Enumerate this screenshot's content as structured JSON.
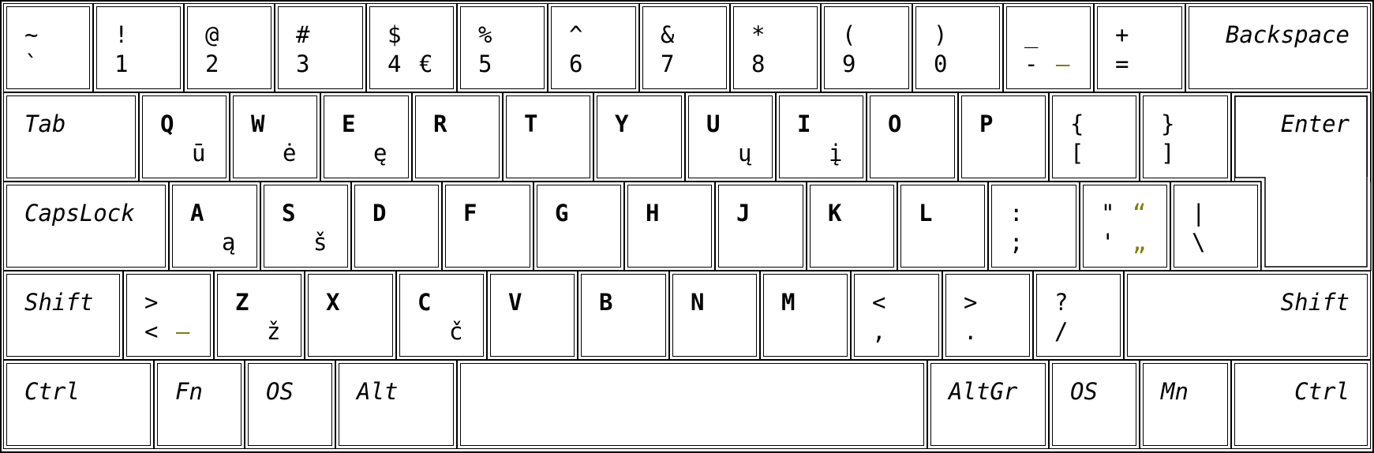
{
  "layout_name": "",
  "colors": {
    "alt_symbol": "#7f7f0a",
    "border": "#000000",
    "background": "#ffffff"
  },
  "rows": [
    [
      {
        "name": "key-tilde",
        "top": "~",
        "bottom": "`"
      },
      {
        "name": "key-1",
        "top": "!",
        "bottom": "1"
      },
      {
        "name": "key-2",
        "top": "@",
        "bottom": "2"
      },
      {
        "name": "key-3",
        "top": "#",
        "bottom": "3"
      },
      {
        "name": "key-4",
        "top": "$",
        "bottom": "4",
        "alt": "€",
        "alt_color": "black"
      },
      {
        "name": "key-5",
        "top": "%",
        "bottom": "5"
      },
      {
        "name": "key-6",
        "top": "^",
        "bottom": "6"
      },
      {
        "name": "key-7",
        "top": "&",
        "bottom": "7"
      },
      {
        "name": "key-8",
        "top": "*",
        "bottom": "8"
      },
      {
        "name": "key-9",
        "top": "(",
        "bottom": "9"
      },
      {
        "name": "key-0",
        "top": ")",
        "bottom": "0"
      },
      {
        "name": "key-minus",
        "top": "_",
        "bottom": "-",
        "alt": "–",
        "alt_color": "olive"
      },
      {
        "name": "key-equals",
        "top": "+",
        "bottom": "="
      },
      {
        "name": "key-backspace",
        "label": "Backspace",
        "special": true,
        "align": "right"
      }
    ],
    [
      {
        "name": "key-tab",
        "label": "Tab",
        "special": true
      },
      {
        "name": "key-q",
        "letter": "Q",
        "alt": "ū"
      },
      {
        "name": "key-w",
        "letter": "W",
        "alt": "ė"
      },
      {
        "name": "key-e",
        "letter": "E",
        "alt": "ę"
      },
      {
        "name": "key-r",
        "letter": "R"
      },
      {
        "name": "key-t",
        "letter": "T"
      },
      {
        "name": "key-y",
        "letter": "Y"
      },
      {
        "name": "key-u",
        "letter": "U",
        "alt": "ų"
      },
      {
        "name": "key-i",
        "letter": "I",
        "alt": "į"
      },
      {
        "name": "key-o",
        "letter": "O"
      },
      {
        "name": "key-p",
        "letter": "P"
      },
      {
        "name": "key-lbracket",
        "top": "{",
        "bottom": "["
      },
      {
        "name": "key-rbracket",
        "top": "}",
        "bottom": "]"
      },
      {
        "name": "key-enter",
        "label": "Enter",
        "special": true,
        "align": "right"
      }
    ],
    [
      {
        "name": "key-capslock",
        "label": "CapsLock",
        "special": true
      },
      {
        "name": "key-a",
        "letter": "A",
        "alt": "ą"
      },
      {
        "name": "key-s",
        "letter": "S",
        "alt": "š"
      },
      {
        "name": "key-d",
        "letter": "D"
      },
      {
        "name": "key-f",
        "letter": "F"
      },
      {
        "name": "key-g",
        "letter": "G"
      },
      {
        "name": "key-h",
        "letter": "H"
      },
      {
        "name": "key-j",
        "letter": "J"
      },
      {
        "name": "key-k",
        "letter": "K"
      },
      {
        "name": "key-l",
        "letter": "L"
      },
      {
        "name": "key-semicolon",
        "top": ":",
        "bottom": ";"
      },
      {
        "name": "key-quote",
        "top": "\"",
        "bottom": "'",
        "alt_top": "“",
        "alt_bottom": "„"
      },
      {
        "name": "key-backslash",
        "top": "|",
        "bottom": "\\"
      }
    ],
    [
      {
        "name": "key-lshift",
        "label": "Shift",
        "special": true
      },
      {
        "name": "key-iso",
        "top": ">",
        "bottom": "<",
        "alt": "–",
        "alt_color": "olive"
      },
      {
        "name": "key-z",
        "letter": "Z",
        "alt": "ž"
      },
      {
        "name": "key-x",
        "letter": "X"
      },
      {
        "name": "key-c",
        "letter": "C",
        "alt": "č"
      },
      {
        "name": "key-v",
        "letter": "V"
      },
      {
        "name": "key-b",
        "letter": "B"
      },
      {
        "name": "key-n",
        "letter": "N"
      },
      {
        "name": "key-m",
        "letter": "M"
      },
      {
        "name": "key-comma",
        "top": "<",
        "bottom": ","
      },
      {
        "name": "key-period",
        "top": ">",
        "bottom": "."
      },
      {
        "name": "key-slash",
        "top": "?",
        "bottom": "/"
      },
      {
        "name": "key-rshift",
        "label": "Shift",
        "special": true,
        "align": "right"
      }
    ],
    [
      {
        "name": "key-lctrl",
        "label": "Ctrl",
        "special": true
      },
      {
        "name": "key-fn",
        "label": "Fn",
        "special": true
      },
      {
        "name": "key-los",
        "label": "OS",
        "special": true
      },
      {
        "name": "key-alt",
        "label": "Alt",
        "special": true
      },
      {
        "name": "key-space",
        "label": "",
        "special": true
      },
      {
        "name": "key-altgr",
        "label": "AltGr",
        "special": true
      },
      {
        "name": "key-ros",
        "label": "OS",
        "special": true
      },
      {
        "name": "key-mn",
        "label": "Mn",
        "special": true
      },
      {
        "name": "key-rctrl",
        "label": "Ctrl",
        "special": true,
        "align": "right"
      }
    ]
  ]
}
